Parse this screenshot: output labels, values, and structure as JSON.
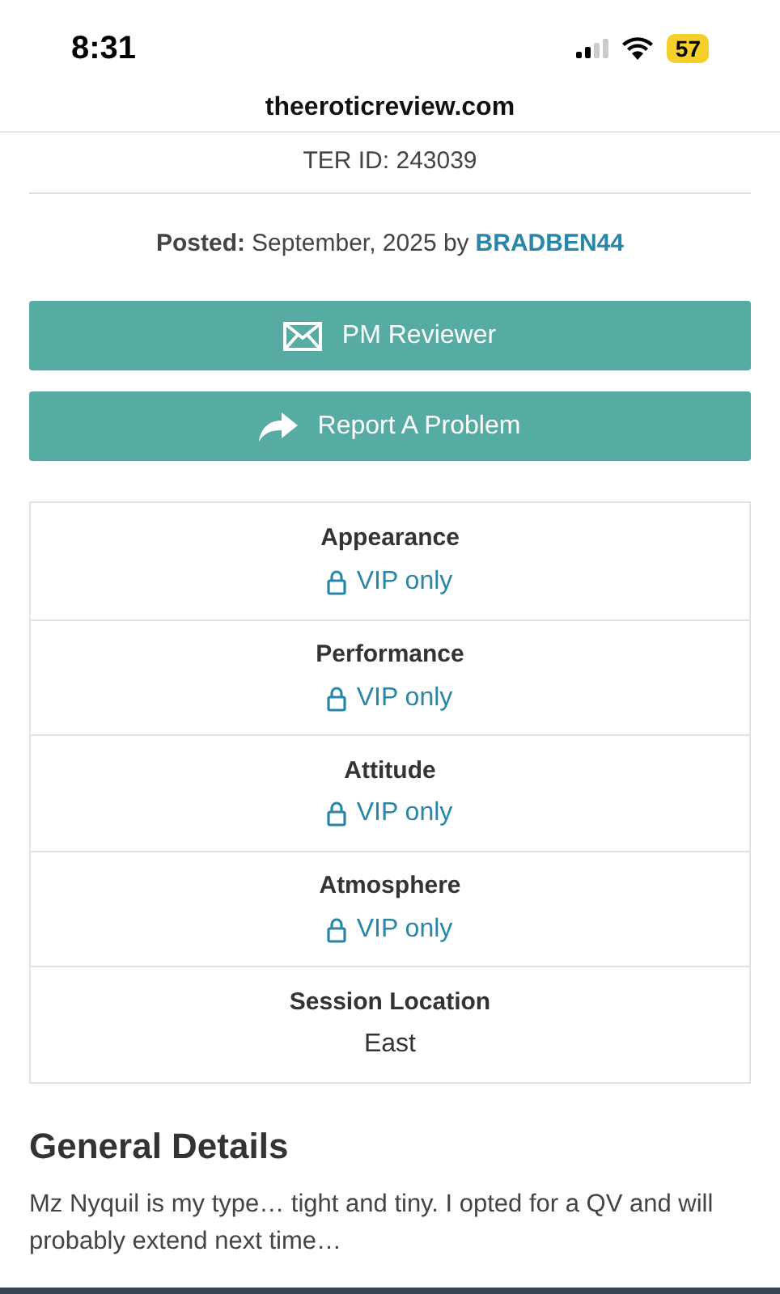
{
  "status_bar": {
    "time": "8:31",
    "battery": "57"
  },
  "address_bar": {
    "url": "theeroticreview.com"
  },
  "review": {
    "ter_id": "TER ID: 243039",
    "posted_label": "Posted:",
    "posted_text": "September, 2025 by",
    "author": "BRADBEN44"
  },
  "buttons": [
    {
      "kind": "mail",
      "label": "PM Reviewer"
    },
    {
      "kind": "share",
      "label": "Report A Problem"
    }
  ],
  "ratings": [
    {
      "label": "Appearance",
      "kind": "locked",
      "value": "VIP only"
    },
    {
      "label": "Performance",
      "kind": "locked",
      "value": "VIP only"
    },
    {
      "label": "Attitude",
      "kind": "locked",
      "value": "VIP only"
    },
    {
      "label": "Atmosphere",
      "kind": "locked",
      "value": "VIP only"
    },
    {
      "label": "Session Location",
      "kind": "plain",
      "value": "East"
    }
  ],
  "general_details": {
    "heading": "General Details",
    "text": "Mz Nyquil is my type… tight and tiny. I opted for a QV and will probably extend next time…"
  }
}
